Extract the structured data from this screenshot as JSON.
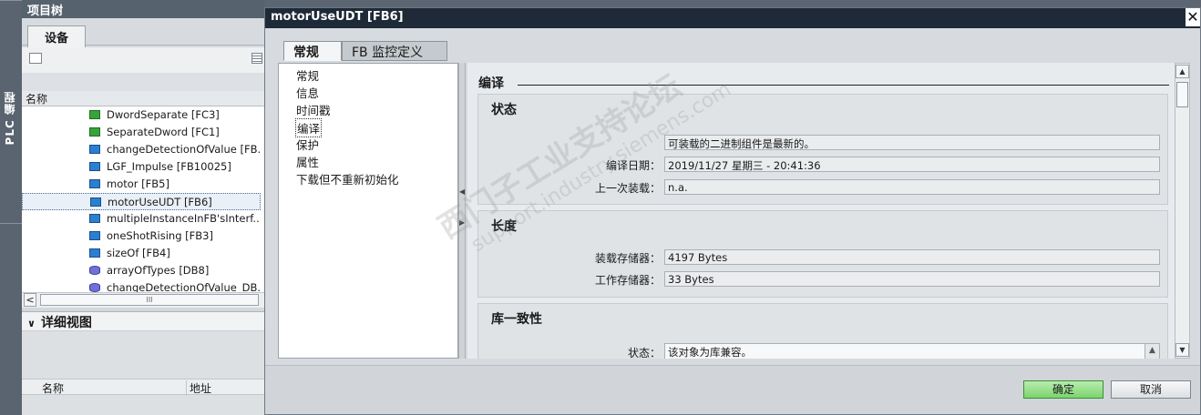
{
  "sidebar": {
    "vertical_tab": "PLC 编程"
  },
  "project_tree": {
    "title": "项目树",
    "devices_tab": "设备",
    "column_name": "名称",
    "items": [
      {
        "label": "DwordSeparate [FC3]",
        "icon": "fc-block-icon",
        "selected": false
      },
      {
        "label": "SeparateDword [FC1]",
        "icon": "fc-block-icon",
        "selected": false
      },
      {
        "label": "changeDetectionOfValue [FB...",
        "icon": "fb-block-icon",
        "selected": false
      },
      {
        "label": "LGF_Impulse [FB10025]",
        "icon": "fb-block-icon",
        "selected": false
      },
      {
        "label": "motor [FB5]",
        "icon": "fb-block-icon",
        "selected": false
      },
      {
        "label": "motorUseUDT [FB6]",
        "icon": "fb-block-icon",
        "selected": true
      },
      {
        "label": "multipleInstanceInFB'sInterf...",
        "icon": "fb-block-icon",
        "selected": false
      },
      {
        "label": "oneShotRising [FB3]",
        "icon": "fb-block-icon",
        "selected": false
      },
      {
        "label": "sizeOf [FB4]",
        "icon": "fb-block-icon",
        "selected": false
      },
      {
        "label": "arrayOfTypes [DB8]",
        "icon": "db-block-icon",
        "selected": false
      },
      {
        "label": "changeDetectionOfValue_DB...",
        "icon": "db-block-icon",
        "selected": false
      }
    ],
    "scroll_left": "<",
    "scroll_grip": "III"
  },
  "detail_view": {
    "title": "详细视图",
    "col_name": "名称",
    "col_address": "地址"
  },
  "dialog": {
    "title": "motorUseUDT [FB6]",
    "close": "✕",
    "tabs": [
      "常规",
      "FB 监控定义"
    ],
    "nav_items": [
      "常规",
      "信息",
      "时间戳",
      "编译",
      "保护",
      "属性",
      "下载但不重新初始化"
    ],
    "nav_selected": 3,
    "section_heading": "编译",
    "status": {
      "title": "状态",
      "message": "可装载的二进制组件是最新的。",
      "compile_date_label": "编译日期：",
      "compile_date": "2019/11/27 星期三 - 20:41:36",
      "last_load_label": "上一次装载：",
      "last_load": "n.a."
    },
    "length": {
      "title": "长度",
      "load_memory_label": "装载存储器：",
      "load_memory": "4197 Bytes",
      "work_memory_label": "工作存储器：",
      "work_memory": "33 Bytes"
    },
    "library": {
      "title": "库一致性",
      "status_label": "状态：",
      "status_value": "该对象为库兼容。"
    },
    "ok_button": "确定",
    "cancel_button": "取消"
  },
  "watermark": {
    "line1": "西门子工业支持论坛",
    "line2": "support.industry.siemens.com"
  }
}
